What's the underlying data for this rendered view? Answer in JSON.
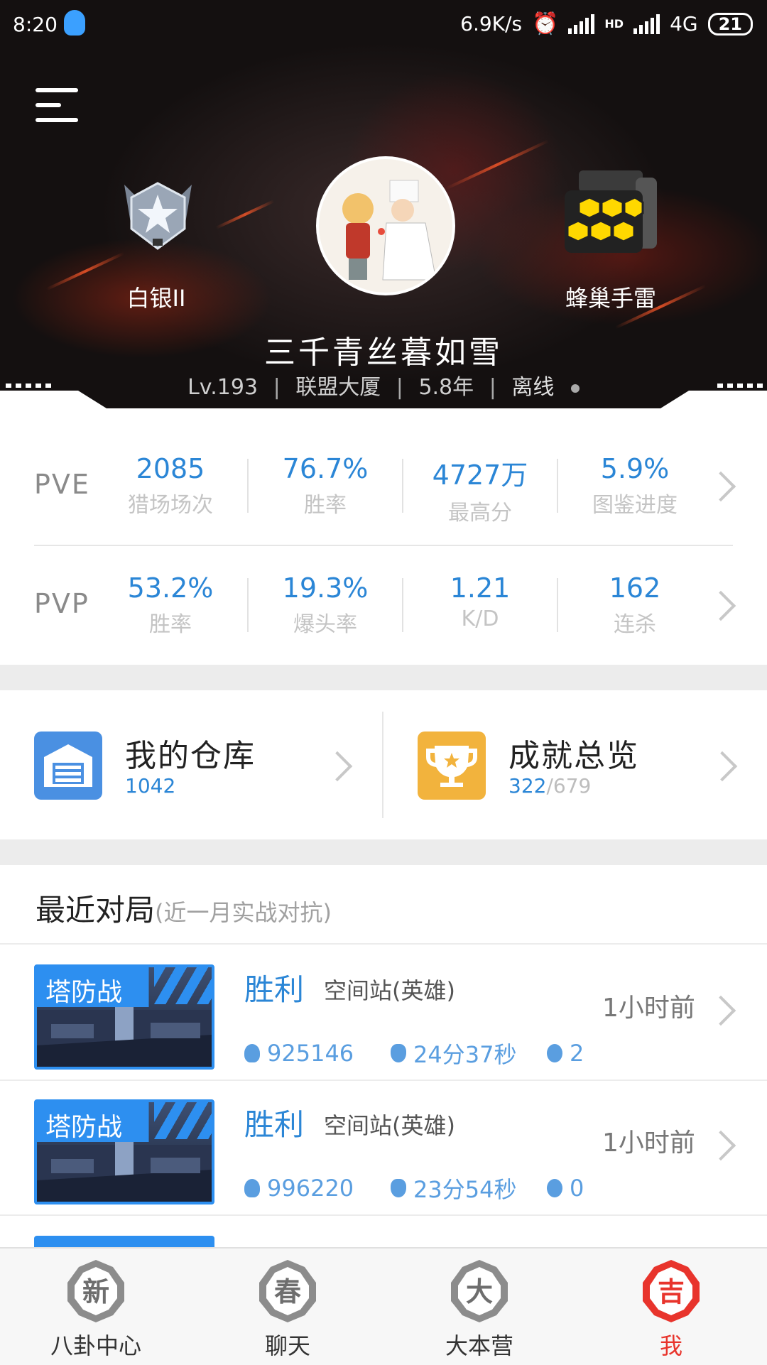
{
  "status_bar": {
    "time": "8:20",
    "speed": "6.9K/s",
    "network": "4G",
    "hd": "HD",
    "battery": "21"
  },
  "profile": {
    "rank_label": "白银II",
    "weapon_label": "蜂巢手雷",
    "name": "三千青丝暮如雪",
    "level": "Lv.193",
    "guild": "联盟大厦",
    "years": "5.8年",
    "status": "离线"
  },
  "pve": {
    "mode": "PVE",
    "stats": [
      {
        "value": "2085",
        "label": "猎场场次"
      },
      {
        "value": "76.7%",
        "label": "胜率"
      },
      {
        "value": "4727万",
        "label": "最高分"
      },
      {
        "value": "5.9%",
        "label": "图鉴进度"
      }
    ]
  },
  "pvp": {
    "mode": "PVP",
    "stats": [
      {
        "value": "53.2%",
        "label": "胜率"
      },
      {
        "value": "19.3%",
        "label": "爆头率"
      },
      {
        "value": "1.21",
        "label": "K/D"
      },
      {
        "value": "162",
        "label": "连杀"
      }
    ]
  },
  "warehouse": {
    "title": "我的仓库",
    "count": "1042",
    "icon": "warehouse-icon",
    "color": "#4a90e2"
  },
  "achievements": {
    "title": "成就总览",
    "done": "322",
    "total": "/679",
    "icon": "trophy-icon",
    "color": "#f2b33d"
  },
  "recent": {
    "title": "最近对局",
    "note": "(近一月实战对抗)",
    "matches": [
      {
        "mode": "塔防战",
        "result": "胜利",
        "map": "空间站(英雄)",
        "ago": "1小时前",
        "score": "925146",
        "duration": "24分37秒",
        "deaths": "2"
      },
      {
        "mode": "塔防战",
        "result": "胜利",
        "map": "空间站(英雄)",
        "ago": "1小时前",
        "score": "996220",
        "duration": "23分54秒",
        "deaths": "0"
      }
    ]
  },
  "tabs": [
    {
      "label": "八卦中心",
      "emblem": "新"
    },
    {
      "label": "聊天",
      "emblem": "春"
    },
    {
      "label": "大本营",
      "emblem": "大"
    },
    {
      "label": "我",
      "emblem": "吉"
    }
  ],
  "colors": {
    "accent": "#2b86d6",
    "tab_active": "#e8342c"
  }
}
